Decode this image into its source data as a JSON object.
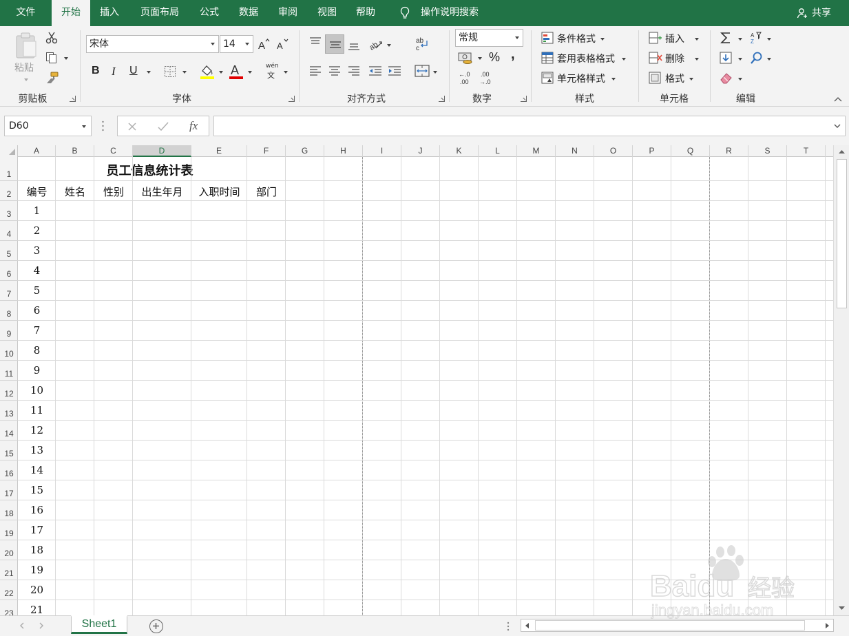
{
  "tabs": [
    {
      "label": "文件",
      "active": false
    },
    {
      "label": "开始",
      "active": true
    },
    {
      "label": "插入",
      "active": false
    },
    {
      "label": "页面布局",
      "active": false
    },
    {
      "label": "公式",
      "active": false
    },
    {
      "label": "数据",
      "active": false
    },
    {
      "label": "审阅",
      "active": false
    },
    {
      "label": "视图",
      "active": false
    },
    {
      "label": "帮助",
      "active": false
    }
  ],
  "search_label": "操作说明搜索",
  "share_label": "共享",
  "ribbon": {
    "clipboard": {
      "label": "剪贴板",
      "paste": "粘贴"
    },
    "font": {
      "label": "字体",
      "font_name": "宋体",
      "font_size": "14",
      "bold": "B",
      "italic": "I",
      "underline": "U",
      "phonetic": "wén"
    },
    "alignment": {
      "label": "对齐方式"
    },
    "number": {
      "label": "数字",
      "format": "常规",
      "percent": "%",
      "comma": ","
    },
    "styles": {
      "label": "样式",
      "conditional": "条件格式",
      "table": "套用表格格式",
      "cell_styles": "单元格样式"
    },
    "cells": {
      "label": "单元格",
      "insert": "插入",
      "delete": "删除",
      "format": "格式"
    },
    "editing": {
      "label": "编辑"
    }
  },
  "name_box": "D60",
  "fx": "fx",
  "columns": [
    "A",
    "B",
    "C",
    "D",
    "E",
    "F",
    "G",
    "H",
    "I",
    "J",
    "K",
    "L",
    "M",
    "N",
    "O",
    "P",
    "Q",
    "R",
    "S",
    "T"
  ],
  "selected_column": "D",
  "rows": [
    "1",
    "2",
    "3",
    "4",
    "5",
    "6",
    "7",
    "8",
    "9",
    "10",
    "11",
    "12",
    "13",
    "14",
    "15",
    "16",
    "17",
    "18",
    "19",
    "20",
    "21",
    "22",
    "23"
  ],
  "sheet": {
    "title": "员工信息统计表",
    "headers": [
      "编号",
      "姓名",
      "性别",
      "出生年月",
      "入职时间",
      "部门"
    ],
    "ids": [
      "1",
      "2",
      "3",
      "4",
      "5",
      "6",
      "7",
      "8",
      "9",
      "10",
      "11",
      "12",
      "13",
      "14",
      "15",
      "16",
      "17",
      "18",
      "19",
      "20",
      "21"
    ]
  },
  "sheet_tab": "Sheet1",
  "watermark": {
    "brand": "Baidu",
    "cn": "经验",
    "url": "jingyan.baidu.com"
  },
  "colors": {
    "accent": "#217346"
  }
}
